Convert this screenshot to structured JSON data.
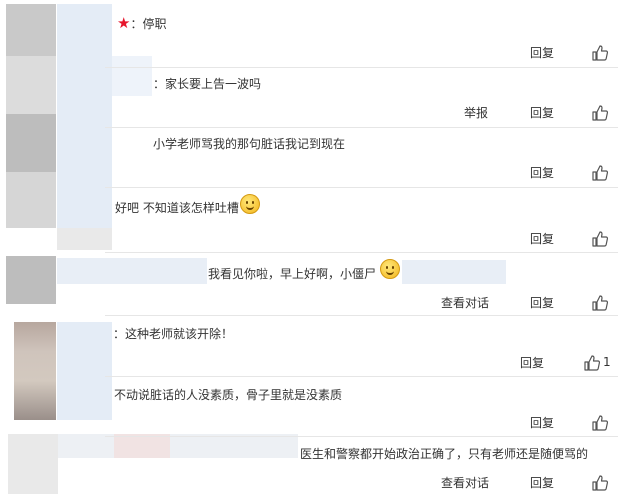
{
  "comments": [
    {
      "text": "：停职"
    },
    {
      "text": "：家长要上告一波吗"
    },
    {
      "text": "小学老师骂我的那句脏话我记到现在"
    },
    {
      "text": "好吧 不知道该怎样吐槽"
    },
    {
      "text": "我看见你啦，早上好啊，小僵尸"
    },
    {
      "text": "：这种老师就该开除！"
    },
    {
      "text": "不动说脏话的人没素质，骨子里就是没素质"
    },
    {
      "text": "医生和警察都开始政治正确了，只有老师还是随便骂的"
    }
  ],
  "actions": {
    "reply": "回复",
    "report": "举报",
    "view_conversation": "查看对话"
  },
  "like_counts": {
    "comment6": "1"
  },
  "icons": {
    "like": "thumbs-up-icon",
    "star": "red-star-icon",
    "emoji": "smile-emoji-icon"
  },
  "colors": {
    "star": "#e6162d",
    "divider": "#e6e6e6",
    "text": "#333333"
  }
}
